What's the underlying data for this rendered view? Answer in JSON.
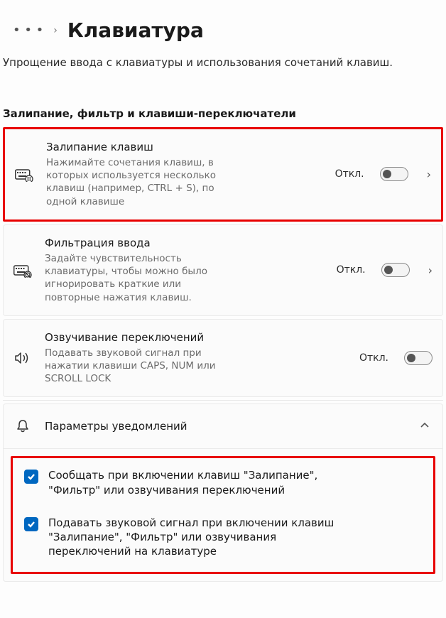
{
  "breadcrumb": {
    "ellipsis": "• • •",
    "separator": "›",
    "title": "Клавиатура"
  },
  "subtitle": "Упрощение ввода с клавиатуры и использования сочетаний клавиш.",
  "section_heading": "Залипание, фильтр и клавиши-переключатели",
  "cards": {
    "sticky": {
      "title": "Залипание клавиш",
      "desc": "Нажимайте сочетания клавиш, в которых используется несколько клавиш (например, CTRL + S), по одной клавише",
      "state": "Откл."
    },
    "filter": {
      "title": "Фильтрация ввода",
      "desc": "Задайте чувствительность клавиатуры, чтобы можно было игнорировать краткие или повторные нажатия клавиш.",
      "state": "Откл."
    },
    "toggle": {
      "title": "Озвучивание переключений",
      "desc": "Подавать звуковой сигнал при нажатии клавиши CAPS, NUM или SCROLL LOCK",
      "state": "Откл."
    }
  },
  "notifications": {
    "title": "Параметры уведомлений",
    "opt1": "Сообщать при включении клавиш \"Залипание\", \"Фильтр\" или озвучивания переключений",
    "opt2": "Подавать звуковой сигнал при включении клавиш \"Залипание\", \"Фильтр\" или озвучивания переключений на клавиатуре"
  }
}
